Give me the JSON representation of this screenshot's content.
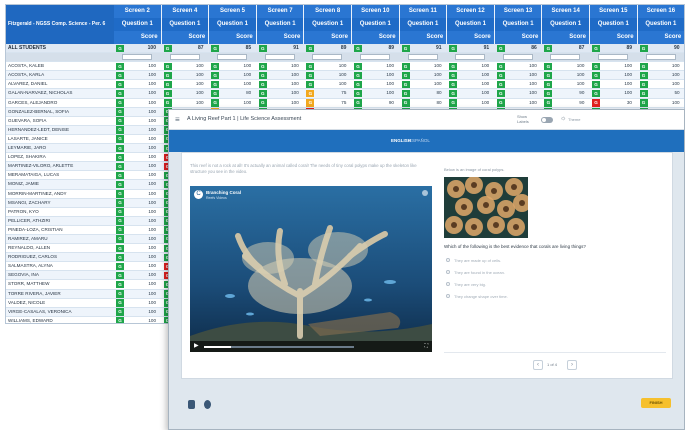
{
  "gradebook": {
    "title": "Fitzgerald - NGSS Comp. Science - Per. 6",
    "screens": [
      {
        "screen": "Screen 2",
        "question": "Question 1",
        "score": "Score"
      },
      {
        "screen": "Screen 4",
        "question": "Question 1",
        "score": "Score"
      },
      {
        "screen": "Screen 5",
        "question": "Question 1",
        "score": "Score"
      },
      {
        "screen": "Screen 7",
        "question": "Question 1",
        "score": "Score"
      },
      {
        "screen": "Screen 8",
        "question": "Question 1",
        "score": "Score"
      },
      {
        "screen": "Screen 10",
        "question": "Question 1",
        "score": "Score"
      },
      {
        "screen": "Screen 11",
        "question": "Question 1",
        "score": "Score"
      },
      {
        "screen": "Screen 12",
        "question": "Question 1",
        "score": "Score"
      },
      {
        "screen": "Screen 13",
        "question": "Question 1",
        "score": "Score"
      },
      {
        "screen": "Screen 14",
        "question": "Question 1",
        "score": "Score"
      },
      {
        "screen": "Screen 15",
        "question": "Question 1",
        "score": "Score"
      },
      {
        "screen": "Screen 16",
        "question": "Question 1",
        "score": "Score"
      }
    ],
    "all_label": "ALL STUDENTS",
    "all_scores": [
      "100",
      "87",
      "85",
      "91",
      "89",
      "89",
      "91",
      "91",
      "86",
      "87",
      "89",
      "90"
    ],
    "students": [
      {
        "name": "ACOSTA, KALEB",
        "marks": [
          "G",
          "G",
          "G",
          "G",
          "G",
          "G",
          "G",
          "G",
          "G",
          "G",
          "G",
          "G"
        ],
        "scores": [
          "100",
          "100",
          "100",
          "100",
          "100",
          "100",
          "100",
          "100",
          "100",
          "100",
          "100",
          "100"
        ]
      },
      {
        "name": "ACOSTA, KARLA",
        "marks": [
          "G",
          "G",
          "G",
          "G",
          "G",
          "G",
          "G",
          "G",
          "G",
          "G",
          "G",
          "G"
        ],
        "scores": [
          "100",
          "100",
          "100",
          "100",
          "100",
          "100",
          "100",
          "100",
          "100",
          "100",
          "100",
          "100"
        ]
      },
      {
        "name": "ALVAREZ, DANIEL",
        "marks": [
          "G",
          "G",
          "G",
          "G",
          "G",
          "G",
          "G",
          "G",
          "G",
          "G",
          "G",
          "G"
        ],
        "scores": [
          "100",
          "100",
          "100",
          "100",
          "100",
          "100",
          "100",
          "100",
          "100",
          "100",
          "100",
          "100"
        ]
      },
      {
        "name": "GALAN-NARVAEZ, NICHOLAS",
        "marks": [
          "G",
          "G",
          "G",
          "G",
          "Y",
          "G",
          "G",
          "G",
          "G",
          "G",
          "G",
          "G"
        ],
        "scores": [
          "100",
          "100",
          "80",
          "100",
          "75",
          "100",
          "80",
          "100",
          "100",
          "90",
          "100",
          "50"
        ]
      },
      {
        "name": "GARCES, ALEJANDRO",
        "marks": [
          "G",
          "G",
          "G",
          "G",
          "Y",
          "G",
          "G",
          "G",
          "G",
          "G",
          "R",
          "G"
        ],
        "scores": [
          "100",
          "100",
          "100",
          "100",
          "75",
          "90",
          "80",
          "100",
          "100",
          "90",
          "30",
          "100"
        ]
      },
      {
        "name": "GONZALEZ-BERNAL, SOFIA",
        "marks": [
          "G",
          "G",
          "Y",
          "G",
          "R",
          "G",
          "G",
          "G",
          "G",
          "G",
          "G",
          "G"
        ],
        "scores": [
          "100",
          "100",
          "75",
          "100",
          "10",
          "100",
          "80",
          "80",
          "80",
          "80",
          "100",
          "80"
        ]
      },
      {
        "name": "GUEVARA, SOFIA",
        "marks": [
          "G",
          "G"
        ],
        "scores": [
          "100"
        ]
      },
      {
        "name": "HERNANDEZ-LEDT, DENISE",
        "marks": [
          "G",
          "G"
        ],
        "scores": [
          "100"
        ]
      },
      {
        "name": "LASARTE, JANICE",
        "marks": [
          "G",
          "G"
        ],
        "scores": [
          "100"
        ]
      },
      {
        "name": "LEYMARIE, JARO",
        "marks": [
          "G",
          "G"
        ],
        "scores": [
          "100"
        ]
      },
      {
        "name": "LOPEZ, SHAKIRA",
        "marks": [
          "G",
          "R"
        ],
        "scores": [
          "100"
        ]
      },
      {
        "name": "MARTINEZ-VILORO, ARLETTE",
        "marks": [
          "G",
          "R"
        ],
        "scores": [
          "100"
        ]
      },
      {
        "name": "MERAMATAIGA, LUCAS",
        "marks": [
          "G",
          "G"
        ],
        "scores": [
          "100"
        ]
      },
      {
        "name": "MONIZ, JAMIE",
        "marks": [
          "G",
          "G"
        ],
        "scores": [
          "100"
        ]
      },
      {
        "name": "MORRIN-MARTINEZ, ANDY",
        "marks": [
          "G",
          "G"
        ],
        "scores": [
          "100"
        ]
      },
      {
        "name": "MSANGI, ZACHARY",
        "marks": [
          "G",
          "G"
        ],
        "scores": [
          "100"
        ]
      },
      {
        "name": "PATRON, KYO",
        "marks": [
          "G",
          "G"
        ],
        "scores": [
          "100"
        ]
      },
      {
        "name": "PELLICER, ATHZIRI",
        "marks": [
          "G",
          "G"
        ],
        "scores": [
          "100"
        ]
      },
      {
        "name": "PINEDA-LOZA, CRISTIAN",
        "marks": [
          "G",
          "G"
        ],
        "scores": [
          "100"
        ]
      },
      {
        "name": "RAMIREZ, AMARU",
        "marks": [
          "G",
          "G"
        ],
        "scores": [
          "100"
        ]
      },
      {
        "name": "REYNALDO, ALLEN",
        "marks": [
          "G",
          "G"
        ],
        "scores": [
          "100"
        ]
      },
      {
        "name": "RODRIGUEZ, CARLOS",
        "marks": [
          "G",
          "G"
        ],
        "scores": [
          "100"
        ]
      },
      {
        "name": "SALMASTRA, ALYNA",
        "marks": [
          "G",
          "R"
        ],
        "scores": [
          "100"
        ]
      },
      {
        "name": "SEGOVIA, INA",
        "marks": [
          "G",
          "R"
        ],
        "scores": [
          "100"
        ]
      },
      {
        "name": "STORR, MATTHEW",
        "marks": [
          "G",
          "G"
        ],
        "scores": [
          "100"
        ]
      },
      {
        "name": "TORRE RIVERA, JAVIER",
        "marks": [
          "G",
          "G"
        ],
        "scores": [
          "100"
        ]
      },
      {
        "name": "VALDEZ, NICOLE",
        "marks": [
          "G",
          "G"
        ],
        "scores": [
          "100"
        ]
      },
      {
        "name": "VIRGE-CASALAS, VERONICA",
        "marks": [
          "G",
          "G"
        ],
        "scores": [
          "100"
        ]
      },
      {
        "name": "WILLIAMS, EDWARD",
        "marks": [
          "G",
          "G"
        ],
        "scores": [
          "100"
        ]
      },
      {
        "name": "YANGOLIN, MARISA",
        "marks": [
          "G",
          "G"
        ],
        "scores": [
          "100"
        ]
      }
    ]
  },
  "assessment": {
    "title": "A Living Reef Part 1 | Life Science Assessment",
    "toggle_label": "Show Labels",
    "theme_label": "Theme",
    "lang_en": "ENGLISH",
    "lang_es": "ESPAÑOL",
    "prompt": "This reef is not a rock at all! It's actually an animal called coral! The needs of tiny coral polyps make up the skeleton like structure you see in the video.",
    "video": {
      "title": "Branching Coral",
      "subtitle": "Reefs Videos",
      "logo": "C",
      "progress": 0.18
    },
    "image_caption": "Below is an image of coral polyps.",
    "question": "Which of the following is the best evidence that corals are living things?",
    "options": [
      "They are made up of cells.",
      "They are found in the ocean.",
      "They are very big.",
      "They change shape over time."
    ],
    "page": "1 of 4",
    "finish": "FINISH"
  },
  "colors": {
    "grade_green": "#1fa64a",
    "grade_red": "#e02020",
    "grade_yellow": "#f2a81e",
    "header_blue": "#2a76d2",
    "finish_yellow": "#f6c02d"
  }
}
